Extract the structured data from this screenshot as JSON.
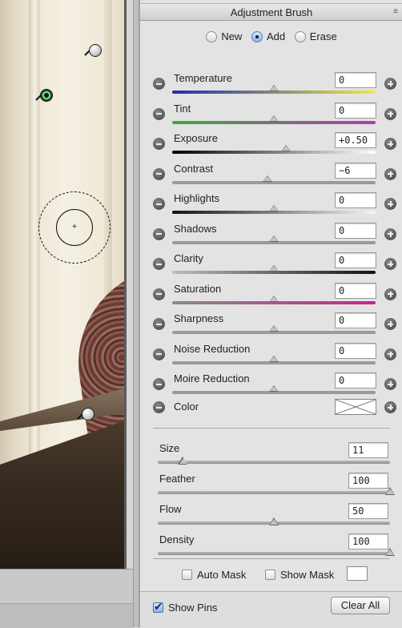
{
  "panel": {
    "title": "Adjustment Brush",
    "menu_icon": "panel-menu-icon"
  },
  "modes": [
    {
      "label": "New",
      "checked": false
    },
    {
      "label": "Add",
      "checked": true
    },
    {
      "label": "Erase",
      "checked": false
    }
  ],
  "adjustments": [
    {
      "label": "Temperature",
      "value": "0",
      "level": 0.5,
      "track_colors": [
        "#1c2fa8",
        "#f0e84a"
      ]
    },
    {
      "label": "Tint",
      "value": "0",
      "level": 0.5,
      "track_colors": [
        "#3fa83c",
        "#b43bb4"
      ]
    },
    {
      "label": "Exposure",
      "value": "+0.50",
      "level": 0.56,
      "track_colors": [
        "#000000",
        "#ffffff"
      ]
    },
    {
      "label": "Contrast",
      "value": "−6",
      "level": 0.47,
      "track_colors": [
        "#9a9a9a",
        "#9a9a9a"
      ]
    },
    {
      "label": "Highlights",
      "value": "0",
      "level": 0.5,
      "track_colors": [
        "#111111",
        "#f5f5f5"
      ]
    },
    {
      "label": "Shadows",
      "value": "0",
      "level": 0.5,
      "track_colors": [
        "#9a9a9a",
        "#9a9a9a"
      ]
    },
    {
      "label": "Clarity",
      "value": "0",
      "level": 0.5,
      "track_colors": [
        "#bdbdbd",
        "#111111"
      ]
    },
    {
      "label": "Saturation",
      "value": "0",
      "level": 0.5,
      "track_colors": [
        "#8a8a8a",
        "#c2278d"
      ]
    },
    {
      "label": "Sharpness",
      "value": "0",
      "level": 0.5,
      "track_colors": [
        "#9a9a9a",
        "#9a9a9a"
      ]
    },
    {
      "label": "Noise Reduction",
      "value": "0",
      "level": 0.5,
      "track_colors": [
        "#9a9a9a",
        "#9a9a9a"
      ]
    },
    {
      "label": "Moire Reduction",
      "value": "0",
      "level": 0.5,
      "track_colors": [
        "#9a9a9a",
        "#9a9a9a"
      ]
    }
  ],
  "color": {
    "label": "Color",
    "swatch": "#ffffff"
  },
  "brush": [
    {
      "label": "Size",
      "value": "11",
      "level": 0.11
    },
    {
      "label": "Feather",
      "value": "100",
      "level": 1.0
    },
    {
      "label": "Flow",
      "value": "50",
      "level": 0.5
    },
    {
      "label": "Density",
      "value": "100",
      "level": 1.0
    }
  ],
  "options": {
    "auto_mask": {
      "label": "Auto Mask",
      "checked": false
    },
    "show_mask": {
      "label": "Show Mask",
      "checked": false
    },
    "show_pins": {
      "label": "Show Pins",
      "checked": true
    }
  },
  "clear_all": "Clear All"
}
